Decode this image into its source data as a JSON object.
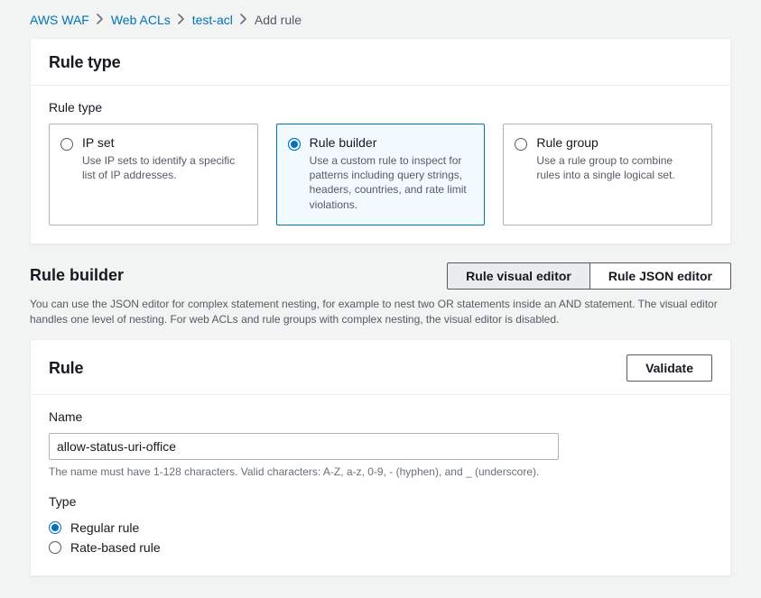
{
  "breadcrumb": {
    "items": [
      {
        "label": "AWS WAF",
        "link": true
      },
      {
        "label": "Web ACLs",
        "link": true
      },
      {
        "label": "test-acl",
        "link": true
      },
      {
        "label": "Add rule",
        "link": false
      }
    ]
  },
  "rule_type_panel": {
    "title": "Rule type",
    "field_label": "Rule type",
    "options": [
      {
        "id": "ip-set",
        "title": "IP set",
        "desc": "Use IP sets to identify a specific list of IP addresses.",
        "selected": false
      },
      {
        "id": "rule-builder",
        "title": "Rule builder",
        "desc": "Use a custom rule to inspect for patterns including query strings, headers, countries, and rate limit violations.",
        "selected": true
      },
      {
        "id": "rule-group",
        "title": "Rule group",
        "desc": "Use a rule group to combine rules into a single logical set.",
        "selected": false
      }
    ]
  },
  "rule_builder_section": {
    "title": "Rule builder",
    "tabs": {
      "visual": "Rule visual editor",
      "json": "Rule JSON editor",
      "active": "visual"
    },
    "help": "You can use the JSON editor for complex statement nesting, for example to nest two OR statements inside an AND statement. The visual editor handles one level of nesting. For web ACLs and rule groups with complex nesting, the visual editor is disabled."
  },
  "rule_panel": {
    "title": "Rule",
    "validate_label": "Validate",
    "name": {
      "label": "Name",
      "value": "allow-status-uri-office",
      "hint": "The name must have 1-128 characters. Valid characters: A-Z, a-z, 0-9, - (hyphen), and _ (underscore)."
    },
    "type": {
      "label": "Type",
      "options": [
        {
          "id": "regular",
          "label": "Regular rule",
          "selected": true
        },
        {
          "id": "rate",
          "label": "Rate-based rule",
          "selected": false
        }
      ]
    }
  }
}
